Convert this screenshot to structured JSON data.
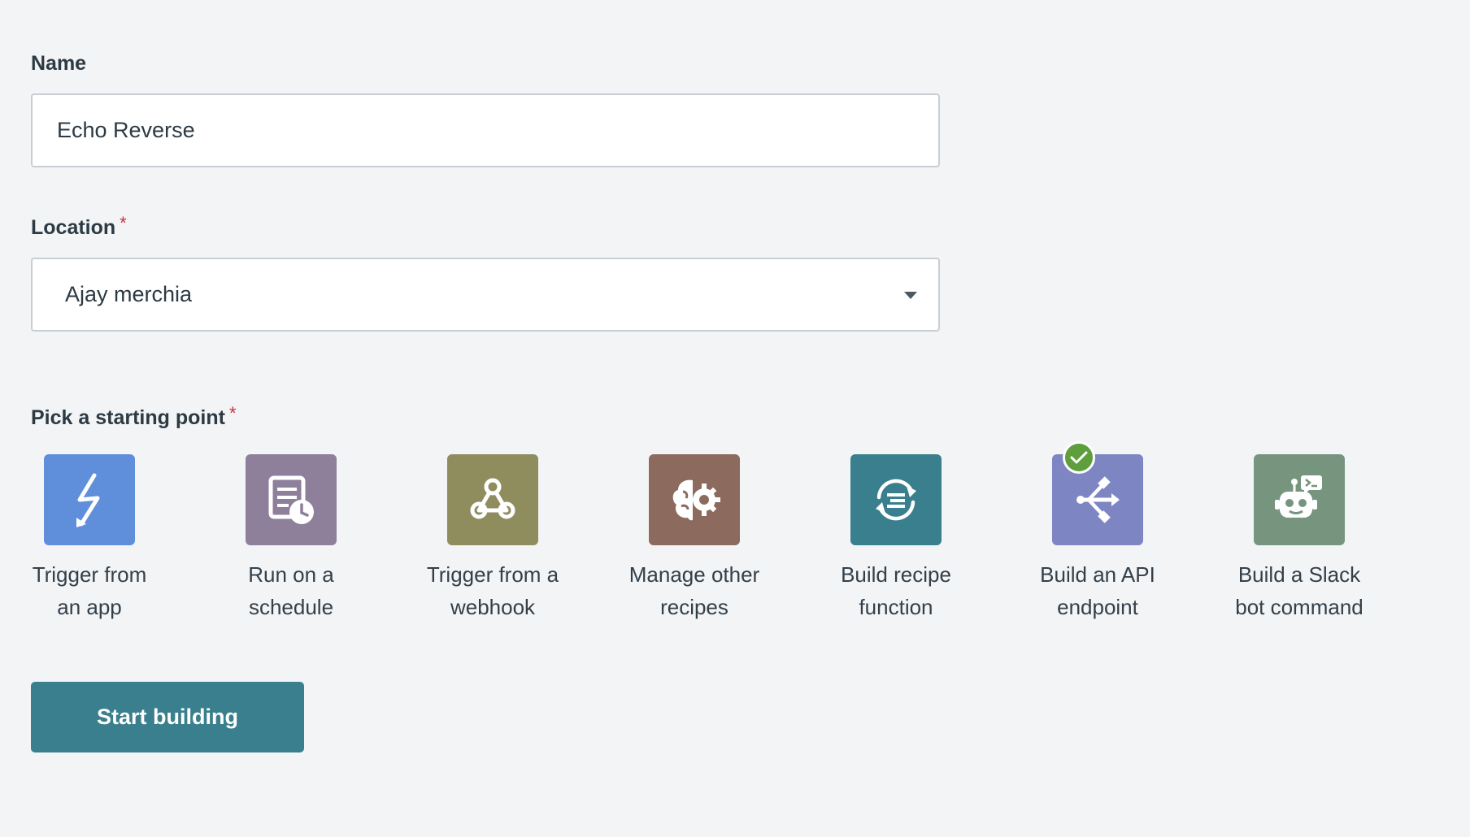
{
  "name_field": {
    "label": "Name",
    "value": "Echo Reverse"
  },
  "location_field": {
    "label": "Location",
    "required_mark": "*",
    "selected": "Ajay merchia"
  },
  "starting_point": {
    "label": "Pick a starting point",
    "required_mark": "*",
    "options": [
      {
        "line1": "Trigger from",
        "line2": "an app",
        "icon": "lightning-bolt-icon",
        "color": "#5f8fdb",
        "selected": false
      },
      {
        "line1": "Run on a",
        "line2": "schedule",
        "icon": "schedule-document-clock-icon",
        "color": "#8e7f9a",
        "selected": false
      },
      {
        "line1": "Trigger from a",
        "line2": "webhook",
        "icon": "webhook-icon",
        "color": "#8f8d5e",
        "selected": false
      },
      {
        "line1": "Manage other",
        "line2": "recipes",
        "icon": "brain-gear-icon",
        "color": "#8c6b5e",
        "selected": false
      },
      {
        "line1": "Build recipe",
        "line2": "function",
        "icon": "function-cycle-icon",
        "color": "#3a7f8d",
        "selected": false
      },
      {
        "line1": "Build an API",
        "line2": "endpoint",
        "icon": "api-endpoint-icon",
        "color": "#7d86c2",
        "selected": true
      },
      {
        "line1": "Build a Slack",
        "line2": "bot command",
        "icon": "robot-chat-icon",
        "color": "#76947e",
        "selected": false
      }
    ]
  },
  "actions": {
    "start_label": "Start building"
  },
  "colors": {
    "background": "#f3f4f6",
    "primary_button": "#3a7f8d",
    "required_mark": "#c8323c",
    "selected_check": "#5e9e3c"
  }
}
